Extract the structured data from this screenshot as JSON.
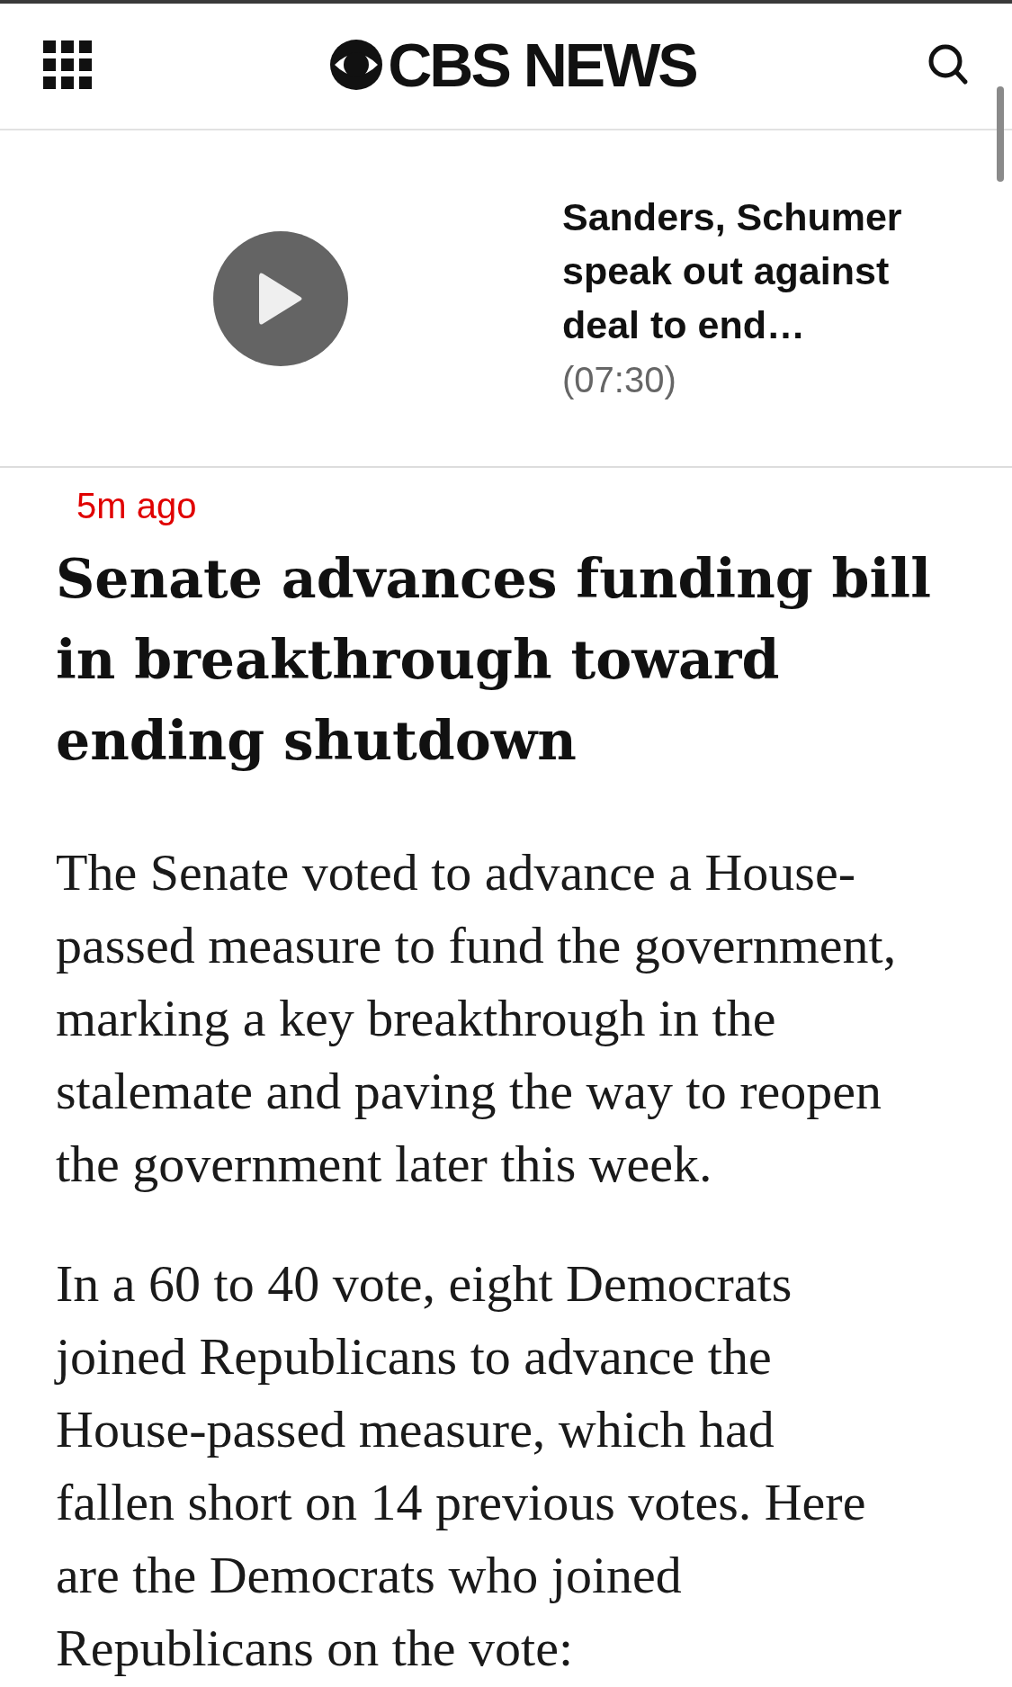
{
  "header": {
    "logo_text": "CBS NEWS"
  },
  "video": {
    "title": "Sanders, Schumer speak out against deal to end…",
    "duration": "(07:30)"
  },
  "article": {
    "timestamp": "5m ago",
    "headline": "Senate advances funding bill in breakthrough toward ending shutdown",
    "paragraphs": [
      "The Senate voted to advance a House-passed measure to fund the government, marking a key breakthrough in the stalemate and paving the way to reopen the government later this week.",
      "In a 60 to 40 vote, eight Democrats joined Republicans to advance the House-passed measure, which had fallen short on 14 previous votes. Here are the Democrats who joined Republicans on the vote:"
    ]
  }
}
